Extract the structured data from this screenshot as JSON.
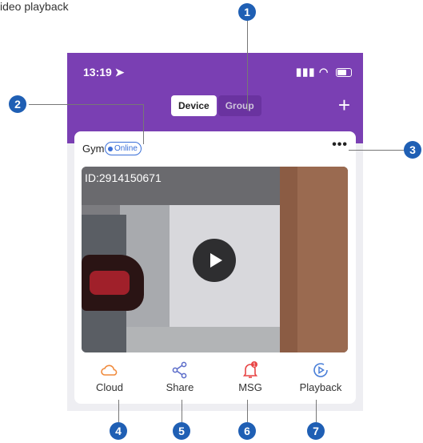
{
  "caption": "ideo playback",
  "status": {
    "time": "13:19"
  },
  "tabs": [
    {
      "label": "Device",
      "active": true
    },
    {
      "label": "Group",
      "active": false
    }
  ],
  "device": {
    "name": "Gym",
    "status": "Online",
    "camera_id": "ID:2914150671"
  },
  "actions": [
    {
      "label": "Cloud",
      "icon": "cloud-icon",
      "color": "#f08a3c"
    },
    {
      "label": "Share",
      "icon": "share-icon",
      "color": "#5b6cc9"
    },
    {
      "label": "MSG",
      "icon": "bell-icon",
      "color": "#e84545",
      "badge": "1"
    },
    {
      "label": "Playback",
      "icon": "playback-icon",
      "color": "#4a7fd8"
    }
  ],
  "callouts": [
    "1",
    "2",
    "3",
    "4",
    "5",
    "6",
    "7"
  ],
  "colors": {
    "header": "#7a3fb3",
    "callout": "#1f5fb4",
    "online": "#3a6fd8"
  }
}
